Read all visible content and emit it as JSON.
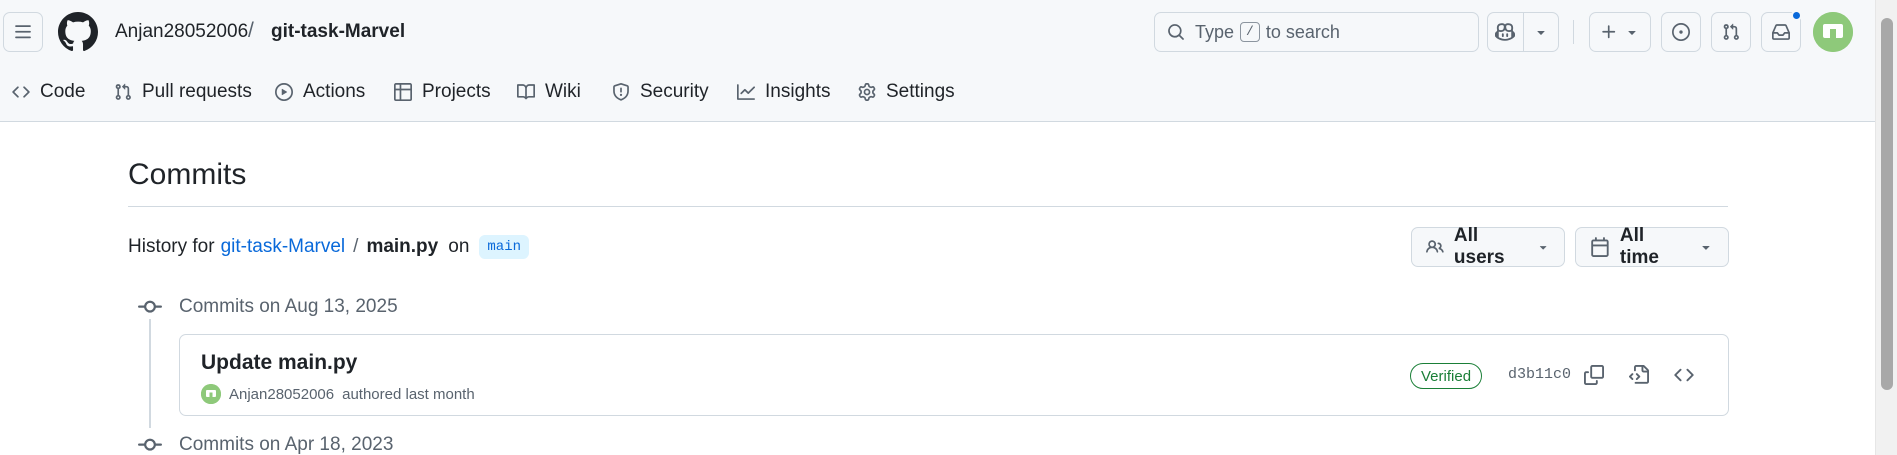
{
  "header": {
    "owner": "Anjan28052006",
    "separator": "/",
    "repo": "git-task-Marvel",
    "search": {
      "prefix": "Type",
      "key": "/",
      "suffix": "to search"
    },
    "icons": [
      "hamburger-icon",
      "github-logo-icon",
      "search-icon",
      "copilot-icon",
      "triangle-down-icon",
      "plus-icon",
      "issue-opened-icon",
      "git-pull-request-icon",
      "inbox-icon",
      "avatar"
    ],
    "accent": "#0969da"
  },
  "repo_nav": {
    "items": [
      {
        "label": "Code",
        "icon": "code-icon"
      },
      {
        "label": "Pull requests",
        "icon": "git-pull-request-icon"
      },
      {
        "label": "Actions",
        "icon": "play-icon"
      },
      {
        "label": "Projects",
        "icon": "table-icon"
      },
      {
        "label": "Wiki",
        "icon": "book-icon"
      },
      {
        "label": "Security",
        "icon": "shield-icon"
      },
      {
        "label": "Insights",
        "icon": "graph-icon"
      },
      {
        "label": "Settings",
        "icon": "gear-icon"
      }
    ]
  },
  "main": {
    "title": "Commits",
    "history": {
      "prefix": "History for",
      "repo_link": "git-task-Marvel",
      "separator": "/",
      "file": "main.py",
      "on": "on",
      "branch": "main"
    },
    "filters": {
      "users": "All users",
      "time": "All time"
    },
    "groups": [
      {
        "label": "Commits on Aug 13, 2025",
        "commits": [
          {
            "message": "Update main.py",
            "author": "Anjan28052006",
            "authored_text": "authored last month",
            "badge": "Verified",
            "sha": "d3b11c0"
          }
        ]
      },
      {
        "label": "Commits on Apr 18, 2023",
        "commits": []
      }
    ],
    "colors": {
      "verified": "#1a7f37",
      "link": "#0969da",
      "branch_bg": "#ddf4ff"
    }
  }
}
